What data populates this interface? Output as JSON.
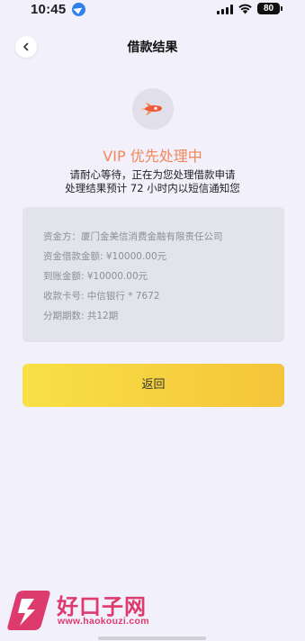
{
  "status_bar": {
    "time": "10:45",
    "battery": "80",
    "location_icon": "location-arrow-icon",
    "signal_icon": "cellular-signal-icon",
    "wifi_icon": "wifi-icon"
  },
  "nav": {
    "title": "借款结果",
    "back_icon": "chevron-left-icon"
  },
  "status": {
    "icon": "rocket-icon",
    "title": "VIP 优先处理中",
    "line1": "请耐心等待，正在为您处理借款申请",
    "line2": "处理结果预计 72 小时内以短信通知您"
  },
  "info": {
    "rows": [
      "资金方：厦门金美信消费金融有限责任公司",
      "资金借款金额: ¥10000.00元",
      "到账金额: ¥10000.00元",
      "收款卡号: 中信银行 * 7672",
      "分期期数: 共12期"
    ]
  },
  "actions": {
    "return_label": "返回"
  },
  "watermark": {
    "text": "好口子网",
    "url": "www.haokouzi.com"
  },
  "colors": {
    "background": "#f1f0fb",
    "accent_orange": "#f2885a",
    "button_start": "#f8e046",
    "button_end": "#f5c43a",
    "card": "#e3e3ec",
    "watermark": "#dd3a6e"
  }
}
